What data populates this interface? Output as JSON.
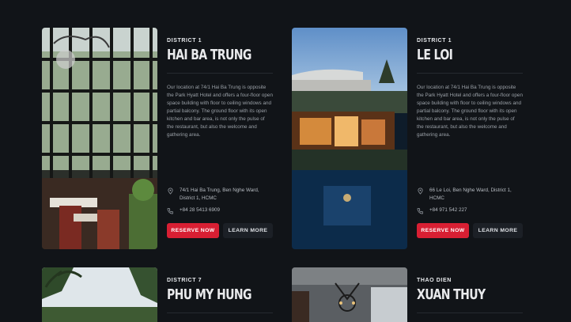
{
  "colors": {
    "background": "#111418",
    "accent": "#d81f33",
    "secondary_button": "#1c2026"
  },
  "locations": [
    {
      "district": "DISTRICT 1",
      "name": "HAI BA TRUNG",
      "description": "Our location at 74/1 Hai Ba Trung is opposite the Park Hyatt Hotel and offers a four-floor open space building with floor to ceiling windows and partial balcony. The ground floor with its open kitchen and bar area, is not only the pulse of the restaurant, but also the welcome and gathering area.",
      "address": "74/1 Hai Ba Trung, Ben Nghe Ward, District 1, HCMC",
      "phone": "+84 28 5413 6909",
      "reserve_label": "RESERVE NOW",
      "learn_label": "LEARN MORE"
    },
    {
      "district": "DISTRICT 1",
      "name": "LE LOI",
      "description": "Our location at 74/1 Hai Ba Trung is opposite the Park Hyatt Hotel and offers a four-floor open space building with floor to ceiling windows and partial balcony. The ground floor with its open kitchen and bar area, is not only the pulse of the restaurant, but also the welcome and gathering area.",
      "address": "66 Le Loi, Ben Nghe Ward, District 1, HCMC",
      "phone": "+84 971 542 227",
      "reserve_label": "RESERVE NOW",
      "learn_label": "LEARN MORE"
    },
    {
      "district": "DISTRICT 7",
      "name": "PHU MY HUNG"
    },
    {
      "district": "THAO DIEN",
      "name": "XUAN THUY"
    }
  ],
  "icons": {
    "address": "map-pin-icon",
    "phone": "phone-icon"
  }
}
